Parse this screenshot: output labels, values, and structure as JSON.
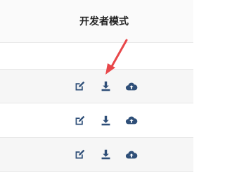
{
  "header": {
    "title": "开发者模式"
  },
  "colors": {
    "icon": "#2f4f78",
    "arrow": "#e8474a",
    "row_alt": "#f6f6f6",
    "border": "#e8e8e8"
  },
  "rows": [
    {
      "icons": []
    },
    {
      "icons": [
        "edit-icon",
        "download-icon",
        "cloud-upload-icon"
      ]
    },
    {
      "icons": [
        "edit-icon",
        "download-icon",
        "cloud-upload-icon"
      ]
    },
    {
      "icons": [
        "edit-icon",
        "download-icon",
        "cloud-upload-icon"
      ]
    }
  ]
}
